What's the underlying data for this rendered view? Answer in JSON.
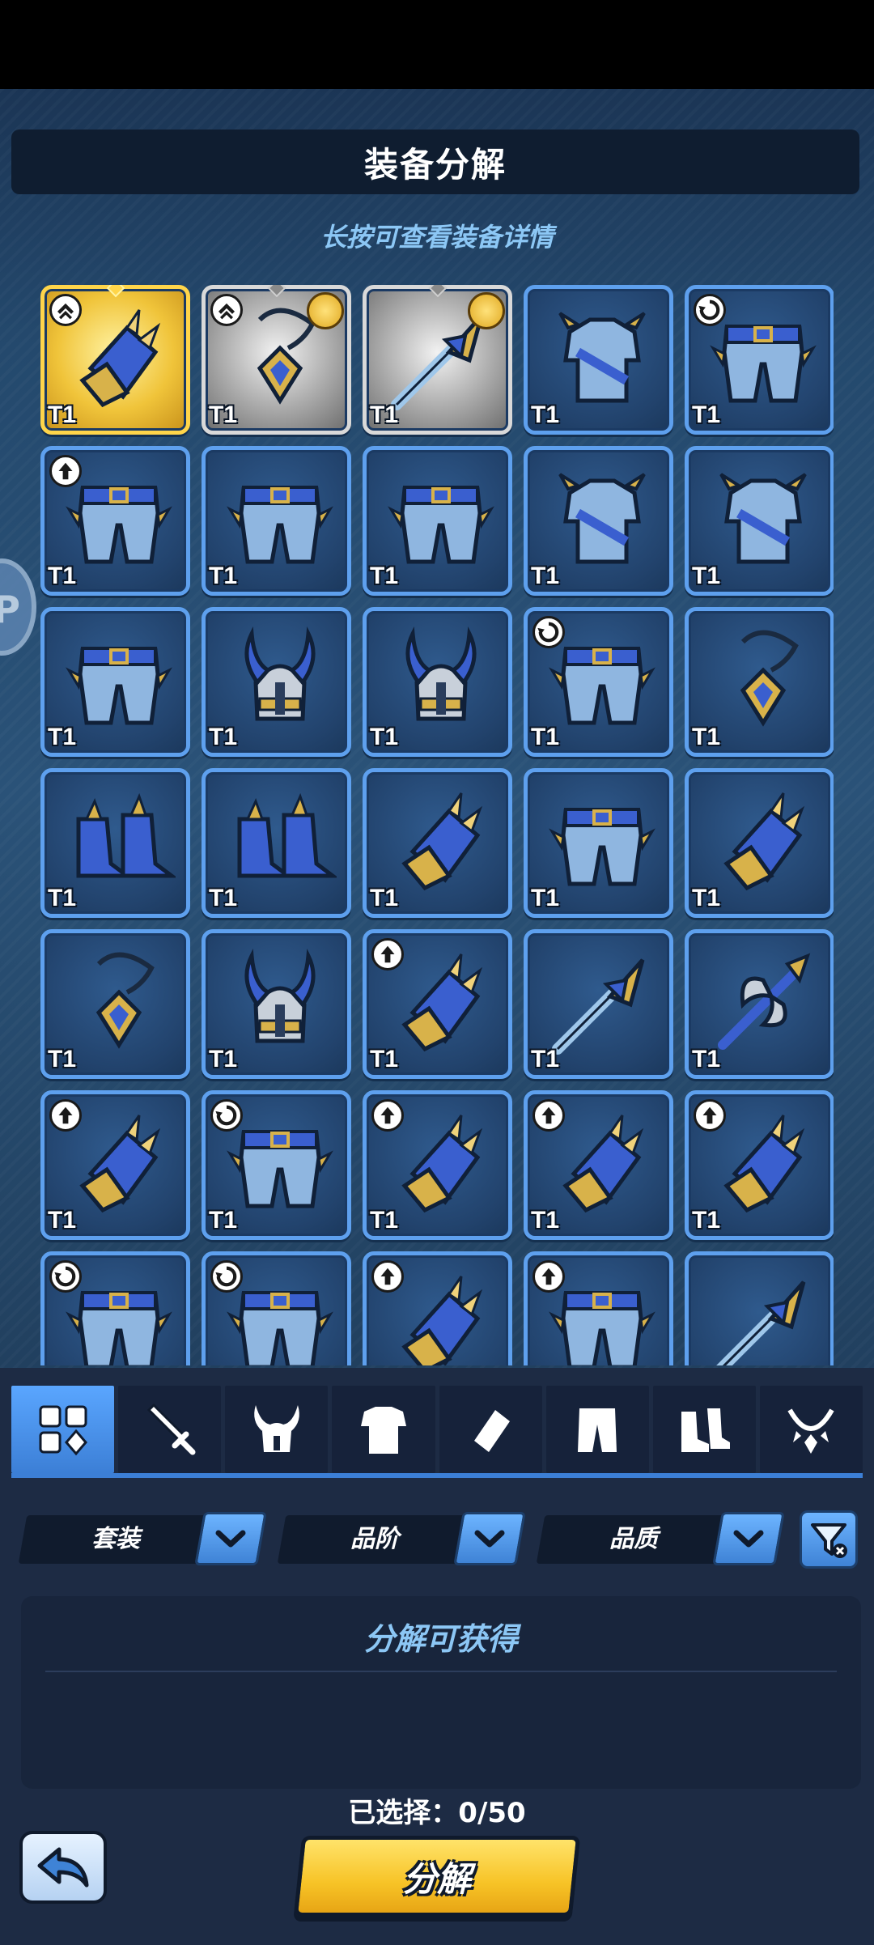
{
  "header": {
    "title": "装备分解",
    "hint": "长按可查看装备详情"
  },
  "side_bubble_text": "P",
  "grid": {
    "items": [
      {
        "type": "bracer",
        "tier": "T1",
        "frame": "gold",
        "badge": "upgrade-chevron",
        "coin": false
      },
      {
        "type": "amulet",
        "tier": "T1",
        "frame": "gray",
        "badge": "upgrade-chevron",
        "coin": true
      },
      {
        "type": "spear",
        "tier": "T1",
        "frame": "gray",
        "badge": "",
        "coin": true
      },
      {
        "type": "chest",
        "tier": "T1",
        "frame": "blue",
        "badge": "",
        "coin": false
      },
      {
        "type": "pants",
        "tier": "T1",
        "frame": "blue",
        "badge": "cycle",
        "coin": false
      },
      {
        "type": "pants",
        "tier": "T1",
        "frame": "blue",
        "badge": "arrow-up",
        "coin": false
      },
      {
        "type": "pants",
        "tier": "T1",
        "frame": "blue",
        "badge": "",
        "coin": false
      },
      {
        "type": "pants",
        "tier": "T1",
        "frame": "blue",
        "badge": "",
        "coin": false
      },
      {
        "type": "chest",
        "tier": "T1",
        "frame": "blue",
        "badge": "",
        "coin": false
      },
      {
        "type": "chest",
        "tier": "T1",
        "frame": "blue",
        "badge": "",
        "coin": false
      },
      {
        "type": "pants",
        "tier": "T1",
        "frame": "blue",
        "badge": "",
        "coin": false
      },
      {
        "type": "helmet",
        "tier": "T1",
        "frame": "blue",
        "badge": "",
        "coin": false
      },
      {
        "type": "helmet",
        "tier": "T1",
        "frame": "blue",
        "badge": "",
        "coin": false
      },
      {
        "type": "pants",
        "tier": "T1",
        "frame": "blue",
        "badge": "cycle",
        "coin": false
      },
      {
        "type": "amulet",
        "tier": "T1",
        "frame": "blue",
        "badge": "",
        "coin": false
      },
      {
        "type": "boots",
        "tier": "T1",
        "frame": "blue",
        "badge": "",
        "coin": false
      },
      {
        "type": "boots",
        "tier": "T1",
        "frame": "blue",
        "badge": "",
        "coin": false
      },
      {
        "type": "bracer",
        "tier": "T1",
        "frame": "blue",
        "badge": "",
        "coin": false
      },
      {
        "type": "pants",
        "tier": "T1",
        "frame": "blue",
        "badge": "",
        "coin": false
      },
      {
        "type": "bracer",
        "tier": "T1",
        "frame": "blue",
        "badge": "",
        "coin": false
      },
      {
        "type": "amulet",
        "tier": "T1",
        "frame": "blue",
        "badge": "",
        "coin": false
      },
      {
        "type": "helmet",
        "tier": "T1",
        "frame": "blue",
        "badge": "",
        "coin": false
      },
      {
        "type": "bracer",
        "tier": "T1",
        "frame": "blue",
        "badge": "arrow-up",
        "coin": false
      },
      {
        "type": "spear",
        "tier": "T1",
        "frame": "blue",
        "badge": "",
        "coin": false
      },
      {
        "type": "axe",
        "tier": "T1",
        "frame": "blue",
        "badge": "",
        "coin": false
      },
      {
        "type": "bracer",
        "tier": "T1",
        "frame": "blue",
        "badge": "arrow-up",
        "coin": false
      },
      {
        "type": "pants",
        "tier": "T1",
        "frame": "blue",
        "badge": "cycle",
        "coin": false
      },
      {
        "type": "bracer",
        "tier": "T1",
        "frame": "blue",
        "badge": "arrow-up",
        "coin": false
      },
      {
        "type": "bracer",
        "tier": "T1",
        "frame": "blue",
        "badge": "arrow-up",
        "coin": false
      },
      {
        "type": "bracer",
        "tier": "T1",
        "frame": "blue",
        "badge": "arrow-up",
        "coin": false
      },
      {
        "type": "pants",
        "tier": "",
        "frame": "blue",
        "badge": "cycle",
        "coin": false
      },
      {
        "type": "pants",
        "tier": "",
        "frame": "blue",
        "badge": "cycle",
        "coin": false
      },
      {
        "type": "bracer",
        "tier": "",
        "frame": "blue",
        "badge": "arrow-up",
        "coin": false
      },
      {
        "type": "pants",
        "tier": "",
        "frame": "blue",
        "badge": "arrow-up",
        "coin": false
      },
      {
        "type": "spear",
        "tier": "",
        "frame": "blue",
        "badge": "",
        "coin": false
      }
    ]
  },
  "tabs": [
    {
      "name": "all",
      "icon": "grid-icon",
      "active": true
    },
    {
      "name": "weapon",
      "icon": "sword-icon",
      "active": false
    },
    {
      "name": "helmet",
      "icon": "horned-helmet-icon",
      "active": false
    },
    {
      "name": "armor",
      "icon": "chest-armor-icon",
      "active": false
    },
    {
      "name": "bracer",
      "icon": "bracer-icon",
      "active": false
    },
    {
      "name": "pants",
      "icon": "pants-icon",
      "active": false
    },
    {
      "name": "boots",
      "icon": "boots-icon",
      "active": false
    },
    {
      "name": "necklace",
      "icon": "necklace-icon",
      "active": false
    }
  ],
  "filters": {
    "set": "套装",
    "rank": "品阶",
    "quality": "品质"
  },
  "rewards": {
    "title": "分解可获得"
  },
  "footer": {
    "selected_label": "已选择：",
    "selected_count": "0/50",
    "decompose_label": "分解"
  },
  "colors": {
    "accent": "#5ea0ee",
    "gold": "#f7c326",
    "hint": "#8cc7f5"
  }
}
